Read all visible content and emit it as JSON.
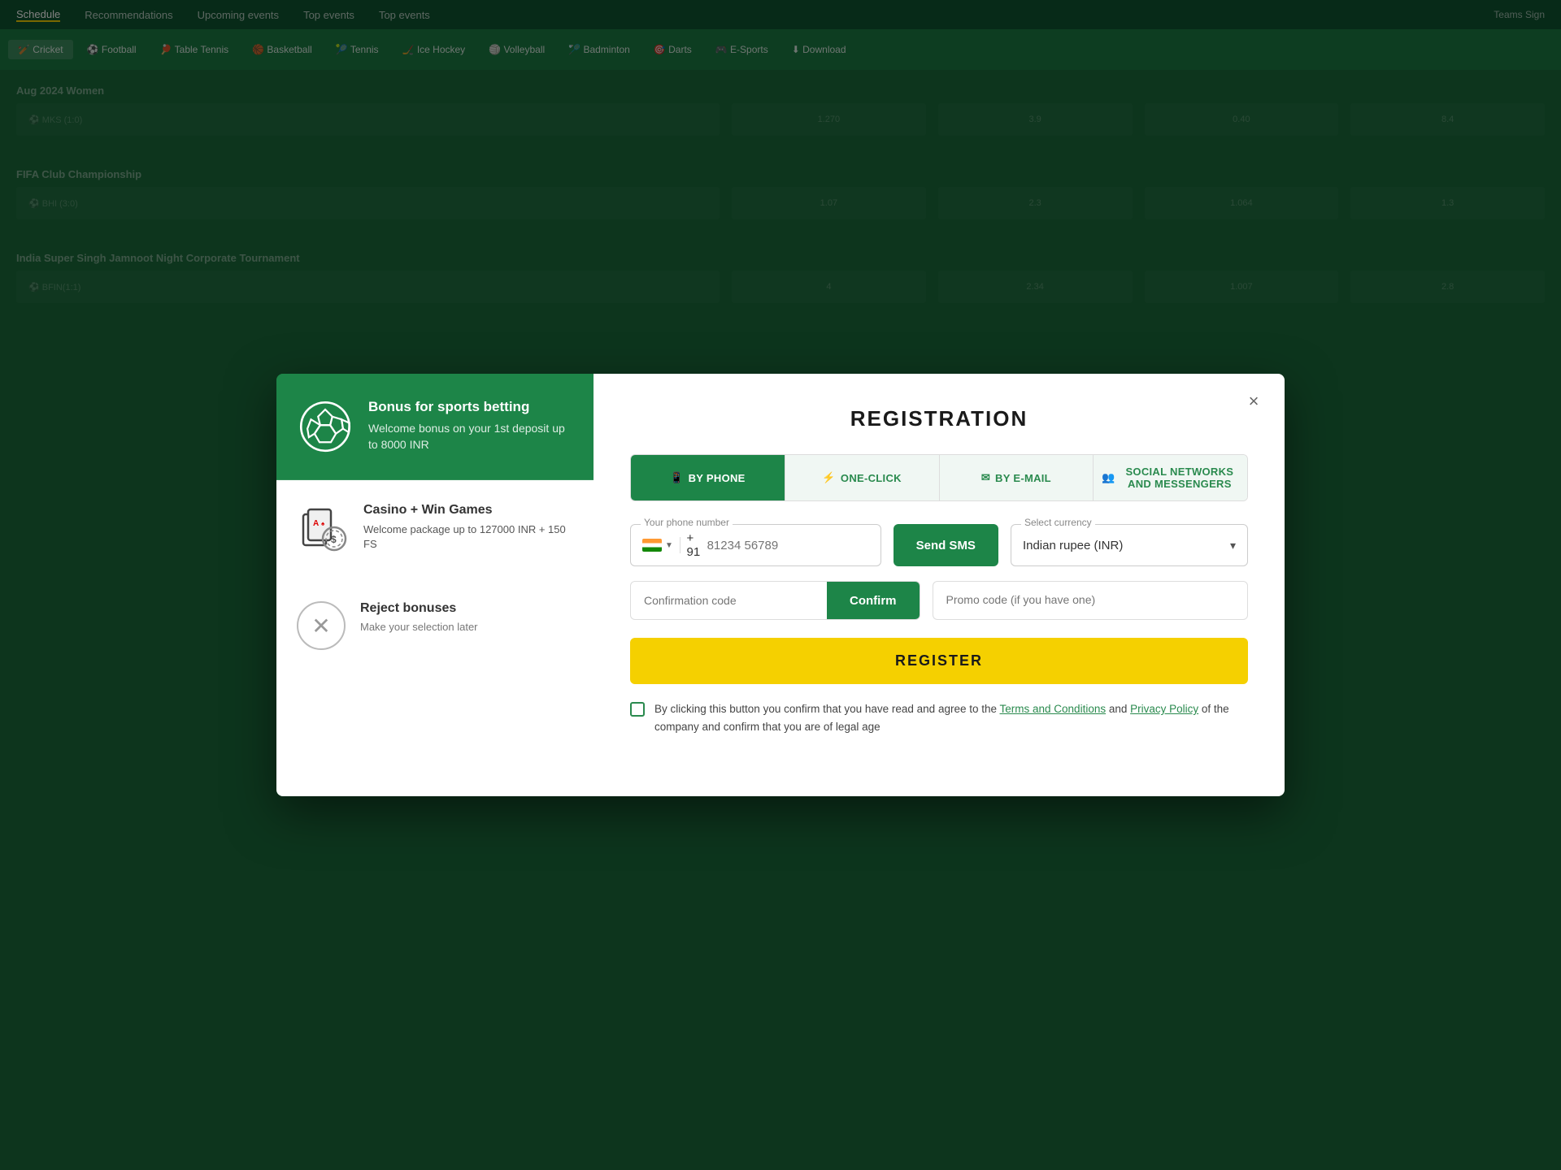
{
  "site": {
    "topbar": {
      "items": [
        "Schedule",
        "Recommendations",
        "Upcoming events",
        "Top events",
        "Top events"
      ]
    },
    "navbar": {
      "items": [
        {
          "label": "Cricket",
          "icon": "🏏",
          "active": false
        },
        {
          "label": "Football",
          "icon": "⚽",
          "active": false
        },
        {
          "label": "Table Tennis",
          "icon": "🏓",
          "active": false
        },
        {
          "label": "Basketball",
          "icon": "🏀",
          "active": false
        },
        {
          "label": "Tennis",
          "icon": "🎾",
          "active": false
        },
        {
          "label": "Ice Hockey",
          "icon": "🏒",
          "active": false
        },
        {
          "label": "Volleyball",
          "icon": "🏐",
          "active": false
        },
        {
          "label": "Badminton",
          "icon": "🏸",
          "active": false
        },
        {
          "label": "Darts",
          "icon": "🎯",
          "active": false
        },
        {
          "label": "E-Sports",
          "icon": "🎮",
          "active": false
        },
        {
          "label": "Download",
          "icon": "⬇",
          "active": false
        }
      ]
    }
  },
  "modal": {
    "close_label": "×",
    "title": "REGISTRATION",
    "tabs": [
      {
        "id": "by-phone",
        "label": "BY PHONE",
        "icon": "📱",
        "active": true
      },
      {
        "id": "one-click",
        "label": "ONE-CLICK",
        "icon": "⚡",
        "active": false
      },
      {
        "id": "by-email",
        "label": "BY E-MAIL",
        "icon": "✉",
        "active": false
      },
      {
        "id": "social",
        "label": "SOCIAL NETWORKS AND MESSENGERS",
        "icon": "👥",
        "active": false
      }
    ],
    "phone_field": {
      "label": "Your phone number",
      "country_code": "+ 91",
      "placeholder": "81234 56789",
      "flag": "IN"
    },
    "send_sms_label": "Send SMS",
    "currency_field": {
      "label": "Select currency",
      "value": "Indian rupee (INR)"
    },
    "confirmation_field": {
      "placeholder": "Confirmation code"
    },
    "confirm_label": "Confirm",
    "promo_field": {
      "placeholder": "Promo code (if you have one)"
    },
    "register_label": "REGISTER",
    "terms": {
      "text_before": "By clicking this button you confirm that you have read and agree to the ",
      "link1": "Terms and Conditions",
      "text_middle": " and ",
      "link2": "Privacy Policy",
      "text_after": " of the company and confirm that you are of legal age"
    }
  },
  "left_panel": {
    "bonus": {
      "title": "Bonus for sports betting",
      "description": "Welcome bonus on your 1st deposit up to 8000 INR"
    },
    "casino": {
      "title": "Casino + Win Games",
      "description": "Welcome package up to 127000 INR + 150 FS"
    },
    "reject": {
      "title": "Reject bonuses",
      "description": "Make your selection later"
    }
  }
}
